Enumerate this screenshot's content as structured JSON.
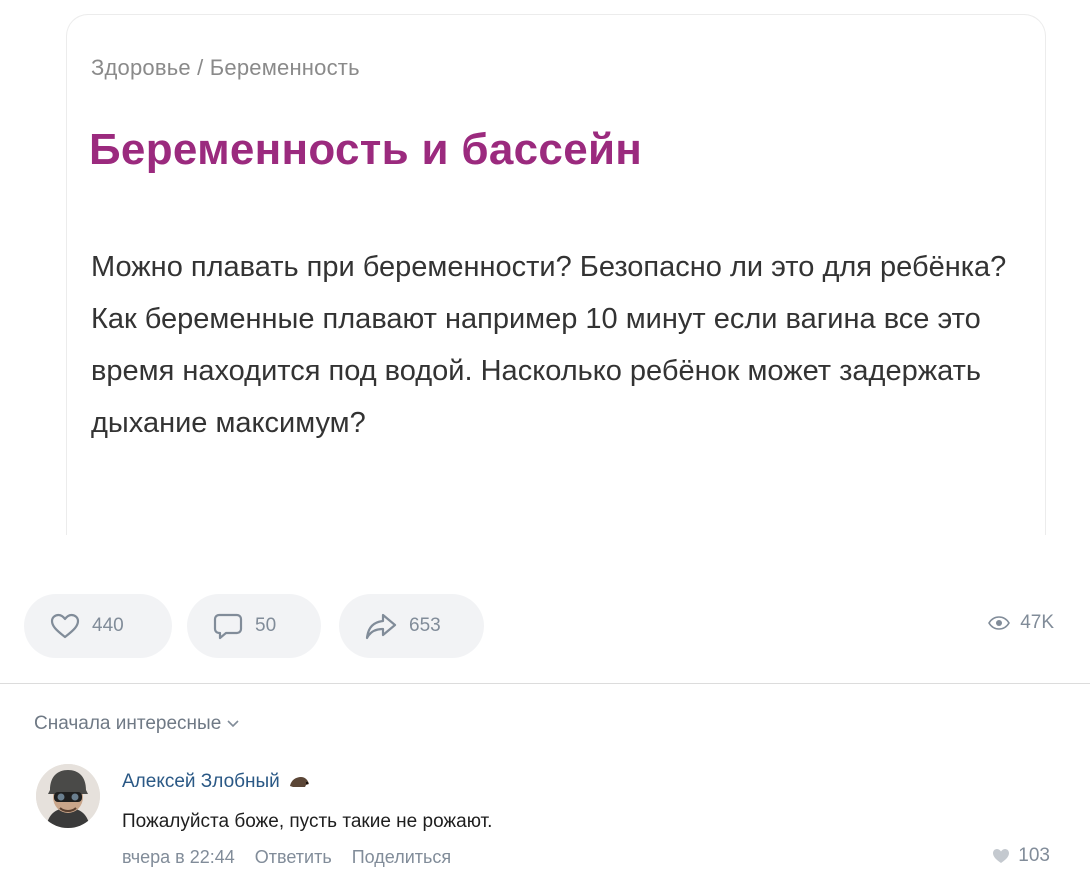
{
  "post": {
    "breadcrumb": "Здоровье / Беременность",
    "title": "Беременность и бассейн",
    "body": "Можно плавать при беременности? Безопасно ли это для ребёнка? Как беременные плавают например 10 минут если вагина все это время находится под водой. Насколько ребёнок может задержать дыхание максимум?"
  },
  "actions": {
    "likes": "440",
    "comments": "50",
    "shares": "653",
    "views": "47K"
  },
  "comments_section": {
    "sort_label": "Сначала интересные",
    "comment": {
      "author": "Алексей Злобный",
      "text": "Пожалуйста боже, пусть такие не рожают.",
      "time": "вчера в 22:44",
      "reply_label": "Ответить",
      "share_label": "Поделиться",
      "likes": "103"
    }
  },
  "colors": {
    "title": "#9b2a7e",
    "author_link": "#2a5885",
    "icon_gray": "#818c99",
    "pill_bg": "#f2f3f5"
  }
}
